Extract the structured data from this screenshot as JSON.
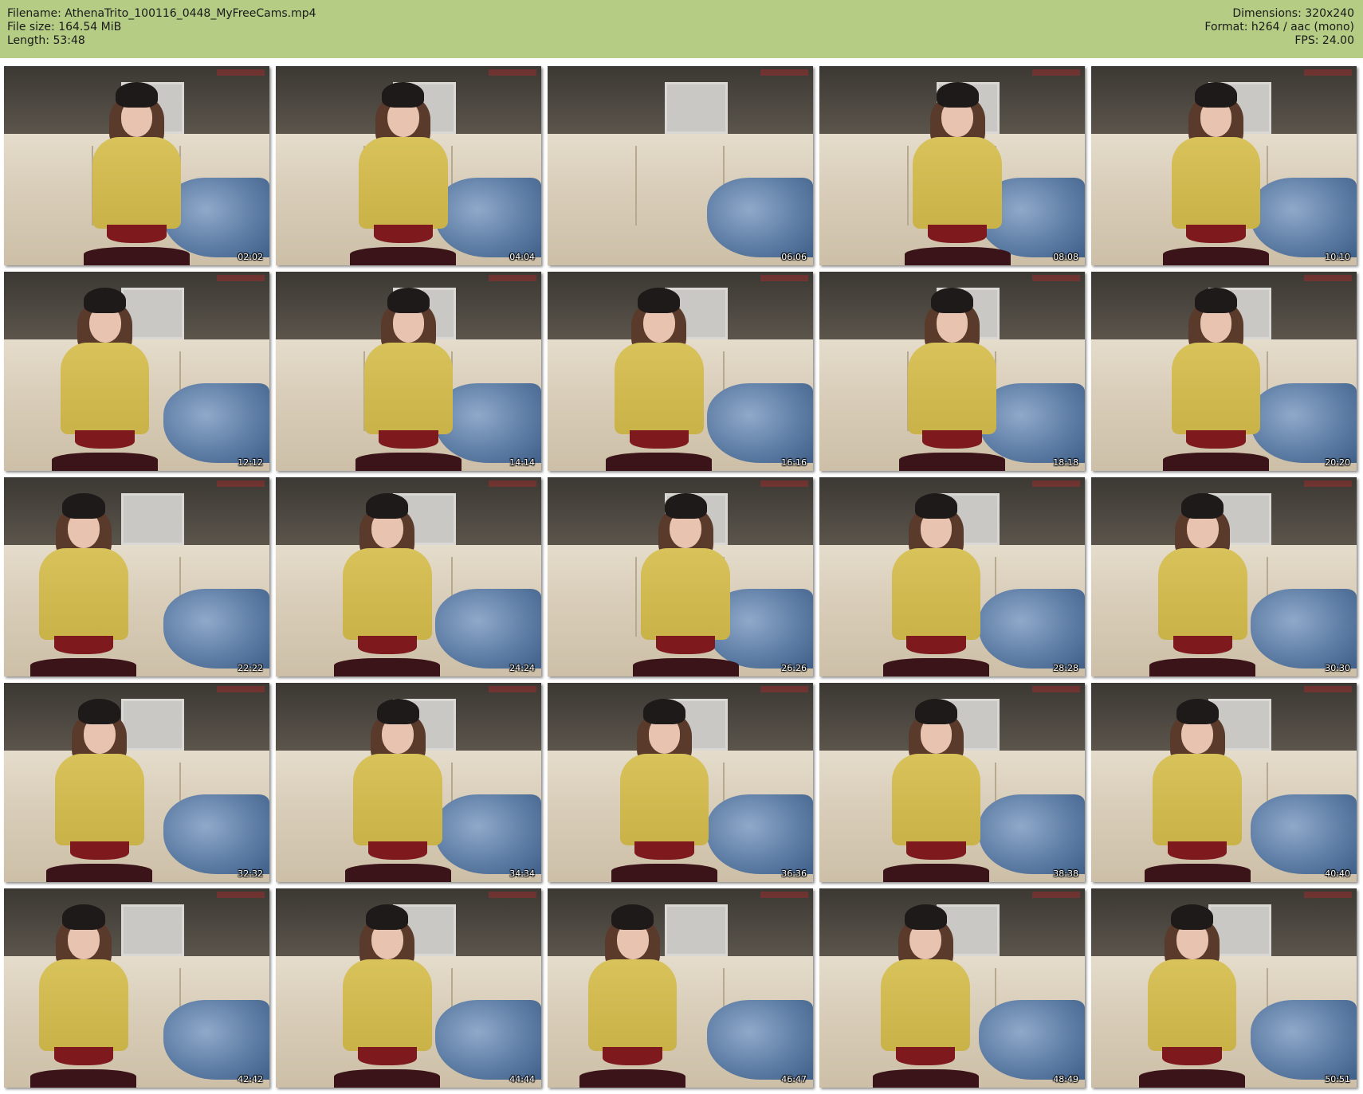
{
  "header": {
    "filename": "Filename: AthenaTrito_100116_0448_MyFreeCams.mp4",
    "filesize": "File size: 164.54 MiB",
    "length": "Length: 53:48",
    "dimensions": "Dimensions: 320x240",
    "format": "Format: h264 / aac (mono)",
    "fps": "FPS: 24.00"
  },
  "colors": {
    "header_bg": "#b4cc84",
    "page_bg": "#ffffff"
  },
  "thumbnails": [
    {
      "timestamp": "02:02"
    },
    {
      "timestamp": "04:04"
    },
    {
      "timestamp": "06:06"
    },
    {
      "timestamp": "08:08"
    },
    {
      "timestamp": "10:10"
    },
    {
      "timestamp": "12:12"
    },
    {
      "timestamp": "14:14"
    },
    {
      "timestamp": "16:16"
    },
    {
      "timestamp": "18:18"
    },
    {
      "timestamp": "20:20"
    },
    {
      "timestamp": "22:22"
    },
    {
      "timestamp": "24:24"
    },
    {
      "timestamp": "26:26"
    },
    {
      "timestamp": "28:28"
    },
    {
      "timestamp": "30:30"
    },
    {
      "timestamp": "32:32"
    },
    {
      "timestamp": "34:34"
    },
    {
      "timestamp": "36:36"
    },
    {
      "timestamp": "38:38"
    },
    {
      "timestamp": "40:40"
    },
    {
      "timestamp": "42:42"
    },
    {
      "timestamp": "44:44"
    },
    {
      "timestamp": "46:47"
    },
    {
      "timestamp": "48:49"
    },
    {
      "timestamp": "50:51"
    }
  ]
}
